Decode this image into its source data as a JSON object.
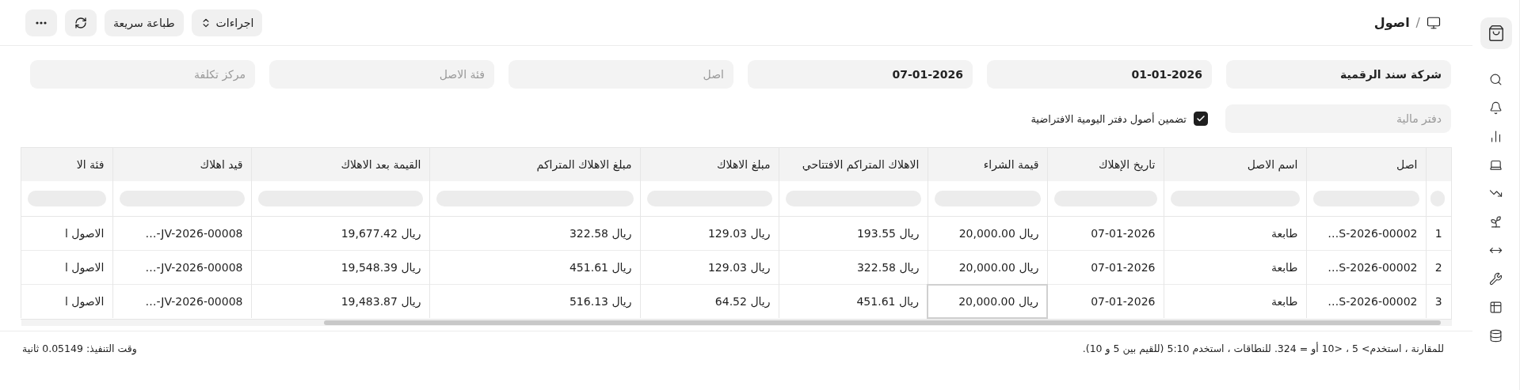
{
  "breadcrumb": {
    "separator": "/",
    "title": "اصول"
  },
  "toolbar": [
    {
      "kind": "menu",
      "label": "اجراءات"
    },
    {
      "kind": "text",
      "label": "طباعة سريعة"
    },
    {
      "kind": "refresh"
    },
    {
      "kind": "more"
    }
  ],
  "filters": [
    {
      "value": "شركة سند الرقمية"
    },
    {
      "value": "01-01-2026"
    },
    {
      "value": "07-01-2026"
    },
    {
      "placeholder": "اصل"
    },
    {
      "placeholder": "فئة الاصل"
    },
    {
      "placeholder": "مركز تكلفة"
    }
  ],
  "filters_row_2": {
    "finance_book": {
      "placeholder": "دفتر مالية"
    },
    "include_default_book": {
      "label": "تضمين أصول دفتر اليومية الافتراضية",
      "checked": true
    }
  },
  "table": {
    "columns": [
      "اصل",
      "اسم الاصل",
      "تاريخ الإهلاك",
      "قيمة الشراء",
      "الاهلاك المتراكم الافتتاحي",
      "مبلغ الاهلاك",
      "مبلغ الاهلاك المتراكم",
      "القيمة بعد الاهلاك",
      "قيد اهلاك",
      "فئة الا"
    ],
    "rows": [
      {
        "index": "1",
        "cells": [
          {
            "text": "…S-2026-00002",
            "focused": false
          },
          {
            "text": "طابعة",
            "focused": false
          },
          {
            "text": "07-01-2026",
            "focused": false
          },
          {
            "text": "ريال 20,000.00",
            "focused": false
          },
          {
            "text": "ريال 193.55",
            "focused": false
          },
          {
            "text": "ريال 129.03",
            "focused": false
          },
          {
            "text": "ريال 322.58",
            "focused": false
          },
          {
            "text": "ريال 19,677.42",
            "focused": false
          },
          {
            "text": "…-JV-2026-00008",
            "focused": false
          },
          {
            "text": "الاصول ا",
            "focused": false
          }
        ]
      },
      {
        "index": "2",
        "cells": [
          {
            "text": "…S-2026-00002",
            "focused": false
          },
          {
            "text": "طابعة",
            "focused": false
          },
          {
            "text": "07-01-2026",
            "focused": false
          },
          {
            "text": "ريال 20,000.00",
            "focused": false
          },
          {
            "text": "ريال 322.58",
            "focused": false
          },
          {
            "text": "ريال 129.03",
            "focused": false
          },
          {
            "text": "ريال 451.61",
            "focused": false
          },
          {
            "text": "ريال 19,548.39",
            "focused": false
          },
          {
            "text": "…-JV-2026-00008",
            "focused": false
          },
          {
            "text": "الاصول ا",
            "focused": false
          }
        ]
      },
      {
        "index": "3",
        "cells": [
          {
            "text": "…S-2026-00002",
            "focused": false
          },
          {
            "text": "طابعة",
            "focused": false
          },
          {
            "text": "07-01-2026",
            "focused": false
          },
          {
            "text": "ريال 20,000.00",
            "focused": true
          },
          {
            "text": "ريال 451.61",
            "focused": false
          },
          {
            "text": "ريال 64.52",
            "focused": false
          },
          {
            "text": "ريال 516.13",
            "focused": false
          },
          {
            "text": "ريال 19,483.87",
            "focused": false
          },
          {
            "text": "…-JV-2026-00008",
            "focused": false
          },
          {
            "text": "الاصول ا",
            "focused": false
          }
        ]
      }
    ]
  },
  "footer": {
    "hint": "للمقارنة ، استخدم> 5 ، <10 أو = 324. للنطاقات ، استخدم 5:10 (للقيم بين 5 و 10).",
    "execution_time": "وقت التنفيذ: 0.05149 ثانية"
  },
  "sidebar": {
    "items": [
      {
        "kind": "bag",
        "selected": true
      },
      {
        "kind": "search",
        "selected": false
      },
      {
        "kind": "bell",
        "selected": false
      },
      {
        "kind": "chart",
        "selected": false
      },
      {
        "kind": "laptop",
        "selected": false
      },
      {
        "kind": "trend",
        "selected": false
      },
      {
        "kind": "sprout",
        "selected": false
      },
      {
        "kind": "arrows",
        "selected": false
      },
      {
        "kind": "tools",
        "selected": false
      },
      {
        "kind": "table",
        "selected": false
      },
      {
        "kind": "database",
        "selected": false
      }
    ]
  }
}
